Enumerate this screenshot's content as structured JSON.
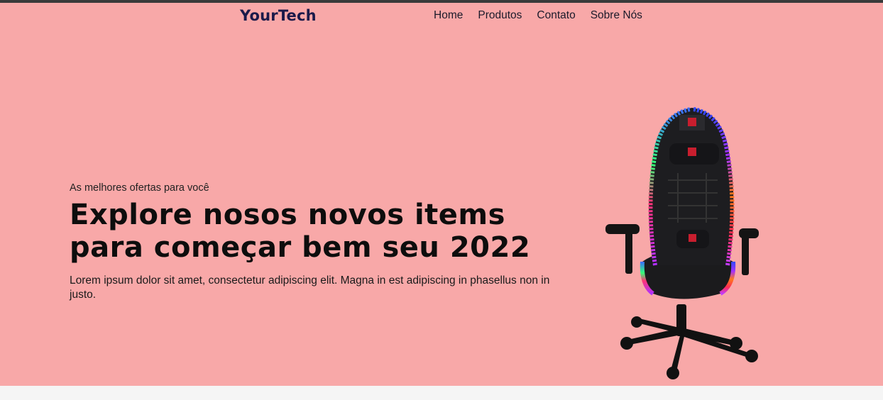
{
  "brand": {
    "name": "YourTech"
  },
  "nav": {
    "items": [
      {
        "label": "Home"
      },
      {
        "label": "Produtos"
      },
      {
        "label": "Contato"
      },
      {
        "label": "Sobre Nós"
      }
    ]
  },
  "hero": {
    "eyebrow": "As melhores ofertas para você",
    "headline": "Explore nosos novos items para começar bem seu 2022",
    "description": "Lorem ipsum dolor sit amet, consectetur adipiscing elit. Magna in est adipiscing in phasellus non in justo.",
    "image_subject": "gaming-chair",
    "background": "#f8a8a8"
  },
  "colors": {
    "logo": "#1b1a4a",
    "text": "#0d0d0d",
    "topline": "#3a3a3a"
  }
}
